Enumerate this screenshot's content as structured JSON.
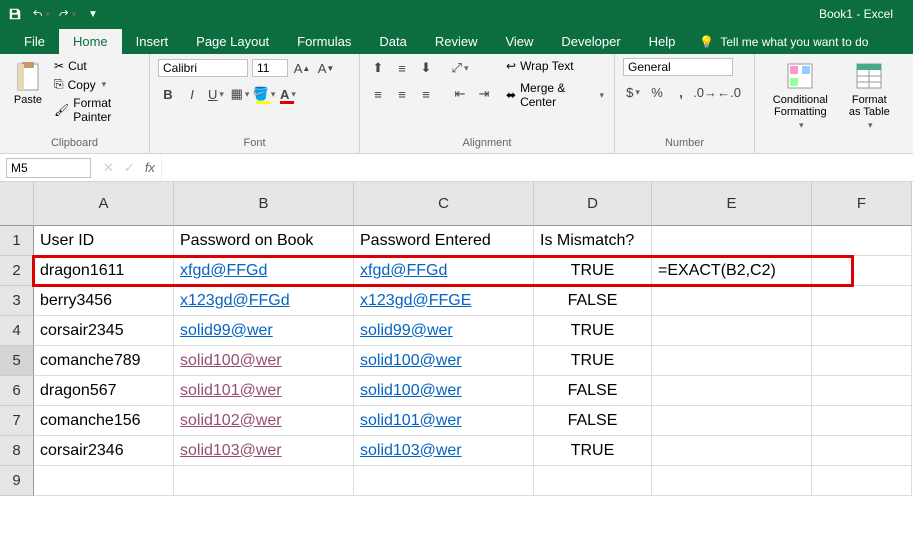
{
  "app": {
    "title": "Book1 - Excel"
  },
  "tabs": {
    "file": "File",
    "home": "Home",
    "insert": "Insert",
    "pagelayout": "Page Layout",
    "formulas": "Formulas",
    "data": "Data",
    "review": "Review",
    "view": "View",
    "developer": "Developer",
    "help": "Help",
    "tellme": "Tell me what you want to do"
  },
  "clipboard": {
    "cut": "Cut",
    "copy": "Copy",
    "fmtpainter": "Format Painter",
    "paste": "Paste",
    "label": "Clipboard"
  },
  "font": {
    "name": "Calibri",
    "size": "11",
    "label": "Font"
  },
  "alignment": {
    "wrap": "Wrap Text",
    "merge": "Merge & Center",
    "label": "Alignment"
  },
  "number": {
    "format": "General",
    "label": "Number"
  },
  "styles": {
    "cond": "Conditional Formatting",
    "tbl": "Format as Table"
  },
  "namebox": "M5",
  "cols": [
    "A",
    "B",
    "C",
    "D",
    "E",
    "F"
  ],
  "rows": [
    "1",
    "2",
    "3",
    "4",
    "5",
    "6",
    "7",
    "8",
    "9"
  ],
  "headers": {
    "A": "User ID",
    "B": "Password on Book",
    "C": "Password Entered",
    "D": "Is Mismatch?"
  },
  "data": [
    {
      "A": "dragon1611",
      "B": "xfgd@FFGd",
      "C": "xfgd@FFGd",
      "D": "TRUE",
      "E": "=EXACT(B2,C2)",
      "bstyle": "link",
      "cstyle": "link"
    },
    {
      "A": "berry3456",
      "B": "x123gd@FFGd",
      "C": "x123gd@FFGE",
      "D": "FALSE",
      "E": "",
      "bstyle": "link",
      "cstyle": "link"
    },
    {
      "A": "corsair2345",
      "B": "solid99@wer",
      "C": "solid99@wer",
      "D": "TRUE",
      "E": "",
      "bstyle": "link",
      "cstyle": "link"
    },
    {
      "A": "comanche789",
      "B": "solid100@wer",
      "C": "solid100@wer",
      "D": "TRUE",
      "E": "",
      "bstyle": "visited",
      "cstyle": "link"
    },
    {
      "A": "dragon567",
      "B": "solid101@wer",
      "C": "solid100@wer",
      "D": "FALSE",
      "E": "",
      "bstyle": "visited",
      "cstyle": "link"
    },
    {
      "A": "comanche156",
      "B": "solid102@wer",
      "C": "solid101@wer",
      "D": "FALSE",
      "E": "",
      "bstyle": "visited",
      "cstyle": "link"
    },
    {
      "A": "corsair2346",
      "B": "solid103@wer",
      "C": "solid103@wer",
      "D": "TRUE",
      "E": "",
      "bstyle": "visited",
      "cstyle": "link"
    }
  ]
}
